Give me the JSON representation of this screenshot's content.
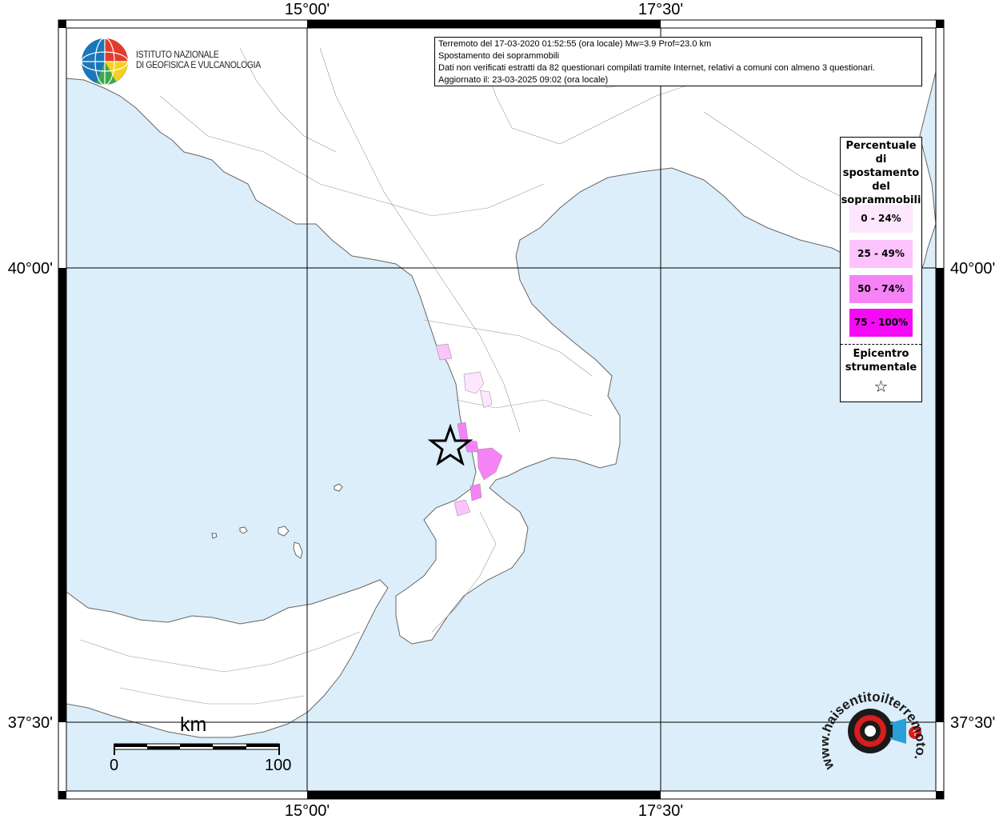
{
  "map": {
    "lon_labels": [
      "15°00'",
      "17°30'"
    ],
    "lat_labels": [
      "40°00'",
      "37°30'"
    ],
    "colors": {
      "sea": "#dbeef9",
      "land": "#ffffff",
      "class_0_24": "#fee6fe",
      "class_25_49": "#fdc3fd",
      "class_50_74": "#f683f6",
      "class_75_100": "#f50af5"
    }
  },
  "info": {
    "line1": "Terremoto del 17-03-2020 01:52:55 (ora locale) Mw=3.9 Prof=23.0 km",
    "line2": "Spostamento dei soprammobili",
    "line3": "Dati non verificati estratti da 82 questionari compilati tramite Internet, relativi a comuni con almeno 3 questionari.",
    "line4": "Aggiornato il: 23-03-2025 09:02 (ora locale)"
  },
  "legend": {
    "title_lines": [
      "Percentuale",
      "di",
      "spostamento",
      "del",
      "soprammobili"
    ],
    "items": [
      {
        "label": "0 - 24%",
        "color": "#fee6fe"
      },
      {
        "label": "25 - 49%",
        "color": "#fdc3fd"
      },
      {
        "label": "50 - 74%",
        "color": "#f683f6"
      },
      {
        "label": "75 - 100%",
        "color": "#f50af5"
      }
    ],
    "epicenter_lines": [
      "Epicentro",
      "strumentale"
    ],
    "epicenter_symbol": "☆"
  },
  "logo_ingv": {
    "line1": "ISTITUTO NAZIONALE",
    "line2": "DI GEOFISICA E VULCANOLOGIA"
  },
  "scale": {
    "unit": "km",
    "start": "0",
    "end": "100"
  },
  "logo_hst": {
    "text": "www.haisentitoilterremoto.it"
  }
}
